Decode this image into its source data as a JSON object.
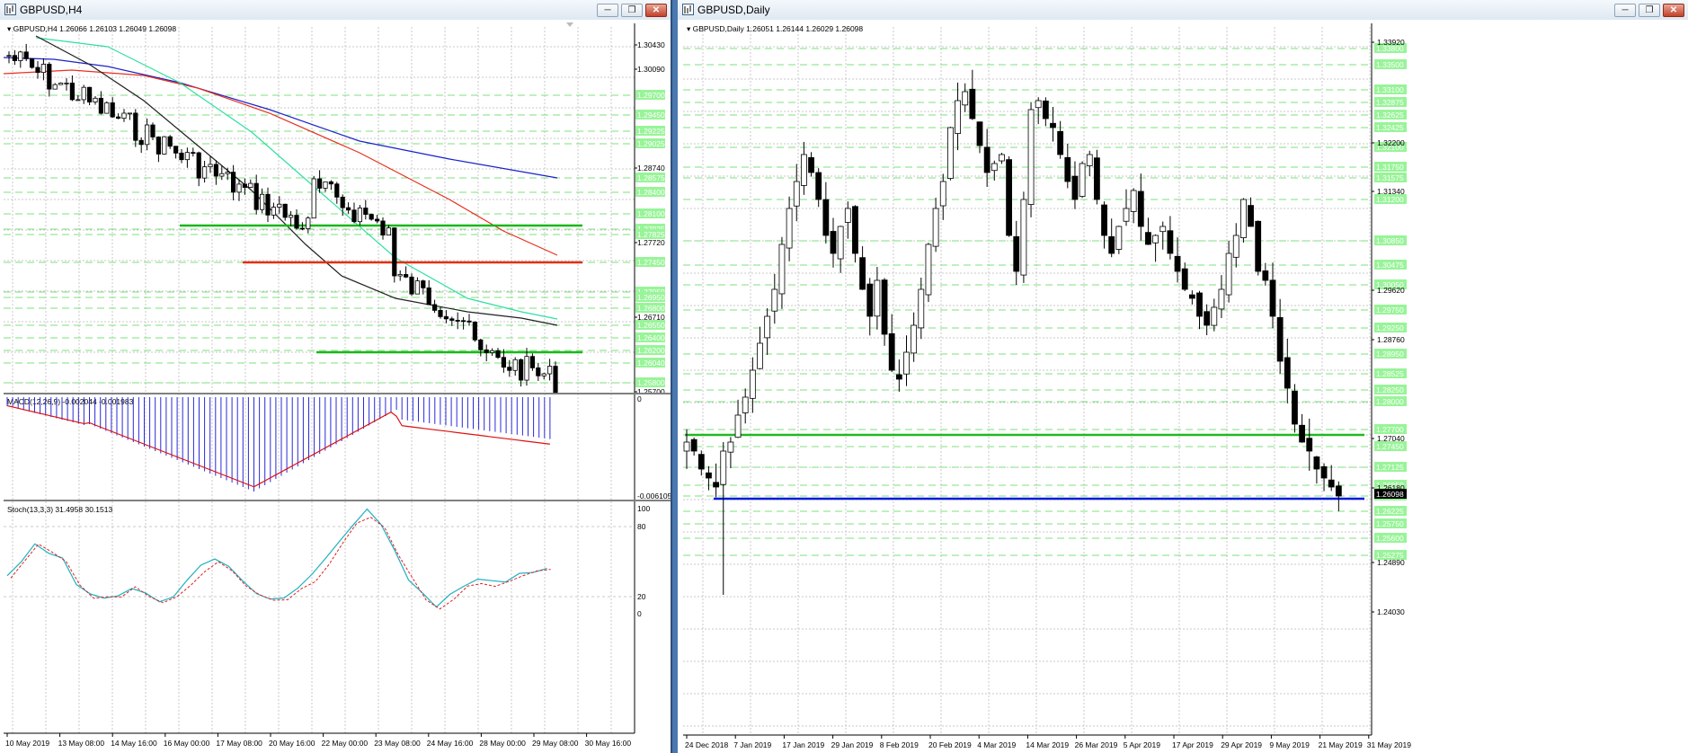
{
  "left_window": {
    "title": "GBPUSD,H4",
    "header": "GBPUSD,H4  1.26066 1.26103 1.26049 1.26098",
    "price_ticks": [
      "1.30430",
      "1.30090",
      "1.28740",
      "1.27720",
      "1.26710",
      "1.25700"
    ],
    "level_labels": [
      "1.29700",
      "1.29450",
      "1.29225",
      "1.29025",
      "1.28575",
      "1.28400",
      "1.28100",
      "1.27925",
      "1.27825",
      "1.27450",
      "1.27050",
      "1.26950",
      "1.26800",
      "1.26550",
      "1.26400",
      "1.26200",
      "1.26040",
      "1.25800"
    ],
    "macd_label": "MACD(12,26,9) -0.002044 -0.001983",
    "macd_ticks": [
      "0",
      "-0.006105"
    ],
    "stoch_label": "Stoch(13,3,3) 31.4958 30.1513",
    "stoch_ticks": [
      "100",
      "80",
      "20",
      "0"
    ],
    "time_labels": [
      "10 May 2019",
      "13 May 08:00",
      "14 May 16:00",
      "16 May 00:00",
      "17 May 08:00",
      "20 May 16:00",
      "22 May 00:00",
      "23 May 08:00",
      "24 May 16:00",
      "28 May 00:00",
      "29 May 08:00",
      "30 May 16:00"
    ]
  },
  "right_window": {
    "title": "GBPUSD,Daily",
    "header": "GBPUSD,Daily  1.26051 1.26144 1.26029 1.26098",
    "price_ticks": [
      "1.33920",
      "1.32200",
      "1.31340",
      "1.29620",
      "1.28760",
      "1.27040",
      "1.26180",
      "1.24890",
      "1.24030"
    ],
    "level_labels": [
      "1.33800",
      "1.33500",
      "1.33100",
      "1.32875",
      "1.32625",
      "1.32425",
      "1.32100",
      "1.31750",
      "1.31575",
      "1.31200",
      "1.30850",
      "1.30475",
      "1.30050",
      "1.29750",
      "1.29250",
      "1.28950",
      "1.28525",
      "1.28250",
      "1.28000",
      "1.27700",
      "1.27450",
      "1.27125",
      "1.26850",
      "1.26550",
      "1.26225",
      "1.26098",
      "1.25750",
      "1.25600",
      "1.25275"
    ],
    "current_price": "1.26098",
    "time_labels": [
      "24 Dec 2018",
      "7 Jan 2019",
      "17 Jan 2019",
      "29 Jan 2019",
      "8 Feb 2019",
      "20 Feb 2019",
      "4 Mar 2019",
      "14 Mar 2019",
      "26 Mar 2019",
      "5 Apr 2019",
      "17 Apr 2019",
      "29 Apr 2019",
      "9 May 2019",
      "21 May 2019",
      "31 May 2019"
    ]
  },
  "colors": {
    "bull": "#ffffff",
    "bear": "#000000",
    "green_level": "#18b818",
    "red_level": "#e03010",
    "blue_level": "#0018e0",
    "label_bg": "#98f498",
    "grid": "#c8c8c8"
  }
}
